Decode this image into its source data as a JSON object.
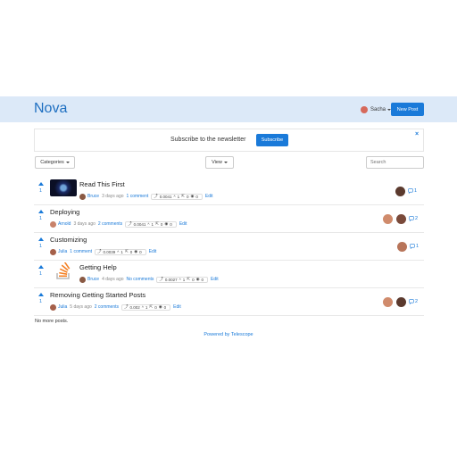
{
  "header": {
    "logo": "Nova",
    "user": {
      "name": "Sacha"
    },
    "new_post_label": "New Post"
  },
  "newsletter": {
    "text": "Subscribe to the newsletter",
    "button": "Subscribe",
    "close": "×"
  },
  "toolbar": {
    "categories_label": "Categories",
    "view_label": "View",
    "search_placeholder": "Search"
  },
  "posts": [
    {
      "title": "Read This First",
      "votes": "1",
      "author": "Bruce",
      "ago": "3 days ago",
      "comments_label": "1 comment",
      "score": "0.0041",
      "upvotes": "1",
      "clicks": "0",
      "views": "0",
      "edit": "Edit",
      "comment_count": "1",
      "thumbnail": "nebula-image"
    },
    {
      "title": "Deploying",
      "votes": "1",
      "author": "Arnold",
      "ago": "3 days ago",
      "comments_label": "2 comments",
      "score": "0.0041",
      "upvotes": "1",
      "clicks": "0",
      "views": "0",
      "edit": "Edit",
      "comment_count": "2",
      "thumbnail": ""
    },
    {
      "title": "Customizing",
      "votes": "1",
      "author": "Julia",
      "ago": "",
      "comments_label": "1 comment",
      "score": "0.0039",
      "upvotes": "1",
      "clicks": "0",
      "views": "0",
      "edit": "Edit",
      "comment_count": "1",
      "thumbnail": ""
    },
    {
      "title": "Getting Help",
      "votes": "1",
      "author": "Bruce",
      "ago": "4 days ago",
      "comments_label": "No comments",
      "score": "0.0027",
      "upvotes": "1",
      "clicks": "0",
      "views": "0",
      "edit": "Edit",
      "comment_count": "",
      "thumbnail": "stackoverflow-logo"
    },
    {
      "title": "Removing Getting Started Posts",
      "votes": "1",
      "author": "Julia",
      "ago": "5 days ago",
      "comments_label": "2 comments",
      "score": "0.002",
      "upvotes": "1",
      "clicks": "0",
      "views": "0",
      "edit": "Edit",
      "comment_count": "2",
      "thumbnail": ""
    }
  ],
  "footer": {
    "no_more": "No more posts.",
    "powered_by": "Powered by Telescope"
  },
  "colors": {
    "accent": "#1a7ad9",
    "header_bg": "#dce9f8"
  }
}
